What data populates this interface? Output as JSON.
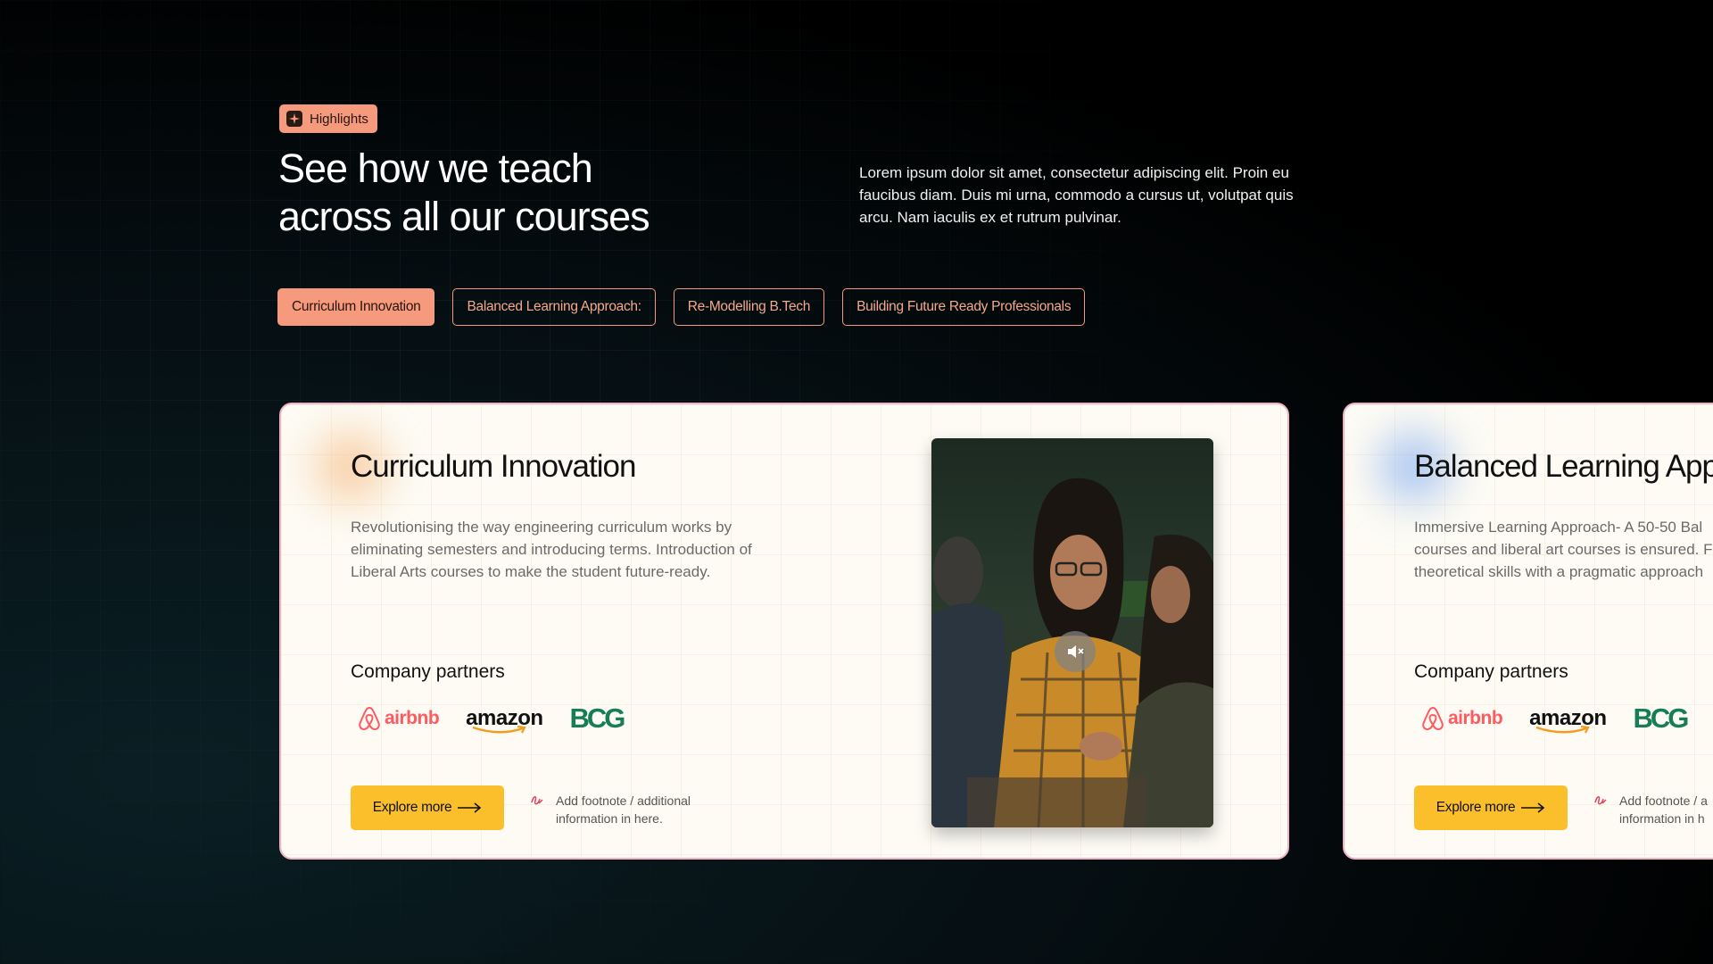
{
  "badge": {
    "label": "Highlights",
    "icon": "sparkle-icon"
  },
  "heading": {
    "line1": "See how we teach",
    "line2": "across all our courses"
  },
  "intro": "Lorem ipsum dolor sit amet, consectetur adipiscing elit. Proin eu faucibus diam. Duis mi urna, commodo a cursus ut, volutpat quis arcu. Nam iaculis ex et rutrum pulvinar.",
  "tabs": [
    {
      "label": "Curriculum Innovation",
      "active": true
    },
    {
      "label": "Balanced Learning Approach:",
      "active": false
    },
    {
      "label": "Re-Modelling B.Tech",
      "active": false
    },
    {
      "label": "Building Future Ready Professionals",
      "active": false
    }
  ],
  "colors": {
    "accent": "#f59a7c",
    "button": "#fbbf2c",
    "card_bg": "#fdfbf4",
    "bcg_green": "#177d56",
    "airbnb_red": "#ff5a5f"
  },
  "cards": [
    {
      "title": "Curriculum Innovation",
      "description": "Revolutionising the way engineering curriculum works by eliminating semesters and introducing terms. Introduction of Liberal Arts courses to make the student future-ready.",
      "partners_label": "Company partners",
      "partners": [
        "airbnb",
        "amazon",
        "BCG"
      ],
      "cta": "Explore more",
      "footnote": "Add footnote / additional information in here.",
      "video": {
        "control": "mute-icon"
      }
    },
    {
      "title": "Balanced Learning App",
      "description_lines": [
        " Immersive  Learning Approach- A 50-50 Bal",
        "courses and liberal art courses is ensured. Fo",
        "theoretical skills with a pragmatic approach"
      ],
      "partners_label": "Company partners",
      "partners": [
        "airbnb",
        "amazon",
        "BCG"
      ],
      "cta": "Explore more",
      "footnote_lines": [
        "Add footnote / a",
        "information in h"
      ]
    }
  ]
}
